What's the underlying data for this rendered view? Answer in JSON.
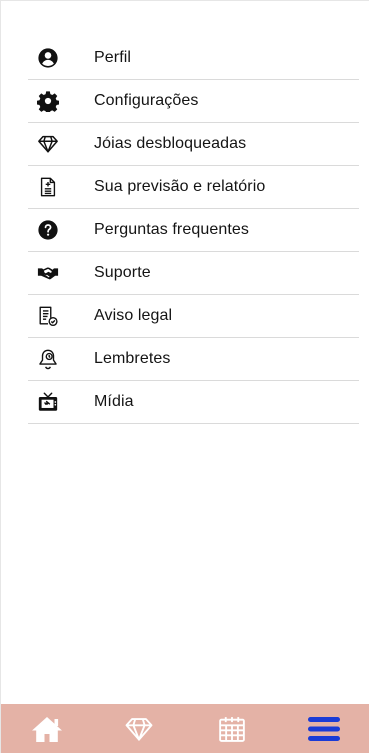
{
  "menu": {
    "items": [
      {
        "id": "perfil",
        "label": "Perfil",
        "icon": "user-circle-icon"
      },
      {
        "id": "configuracoes",
        "label": "Configurações",
        "icon": "gear-icon"
      },
      {
        "id": "joias",
        "label": "Jóias desbloqueadas",
        "icon": "diamond-icon"
      },
      {
        "id": "previsao",
        "label": "Sua previsão e relatório",
        "icon": "report-document-icon"
      },
      {
        "id": "perguntas",
        "label": "Perguntas frequentes",
        "icon": "question-circle-icon"
      },
      {
        "id": "suporte",
        "label": "Suporte",
        "icon": "handshake-icon"
      },
      {
        "id": "aviso",
        "label": "Aviso legal",
        "icon": "legal-document-icon"
      },
      {
        "id": "lembretes",
        "label": "Lembretes",
        "icon": "bell-icon"
      },
      {
        "id": "midia",
        "label": "Mídia",
        "icon": "tv-icon"
      }
    ]
  },
  "bottom_nav": {
    "items": [
      {
        "id": "home",
        "icon": "home-icon"
      },
      {
        "id": "gems",
        "icon": "diamond-icon"
      },
      {
        "id": "calendar",
        "icon": "calendar-icon"
      },
      {
        "id": "menu",
        "icon": "hamburger-menu-icon",
        "active": true
      }
    ],
    "background_color": "#e4b2a6",
    "icon_color": "#ffffff",
    "active_color": "#1a3bd6"
  }
}
